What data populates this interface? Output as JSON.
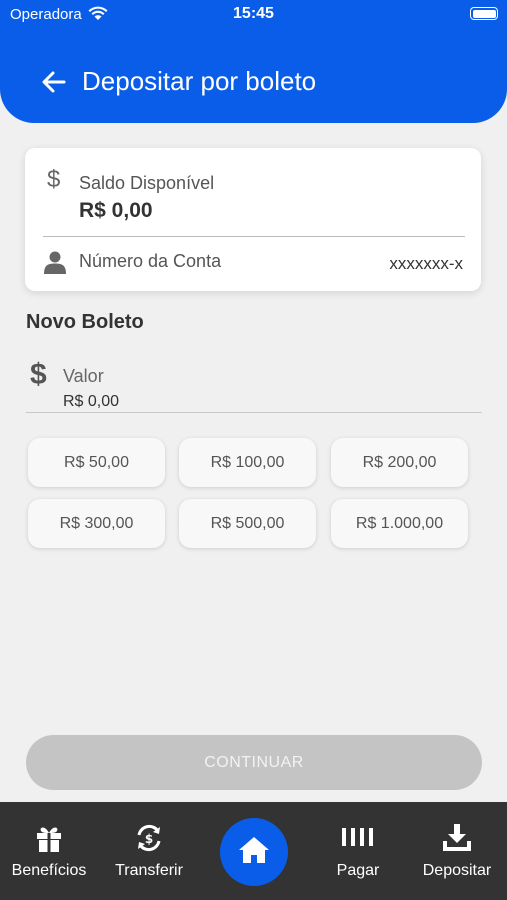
{
  "status_bar": {
    "carrier": "Operadora",
    "time": "15:45"
  },
  "header": {
    "title": "Depositar por boleto"
  },
  "account_card": {
    "balance_label": "Saldo Disponível",
    "balance_value": "R$ 0,00",
    "account_label": "Número da Conta",
    "account_value": "xxxxxxx-x"
  },
  "new_boleto": {
    "title": "Novo Boleto",
    "amount_label": "Valor",
    "amount_value": "R$ 0,00",
    "quick_amounts": [
      "R$ 50,00",
      "R$ 100,00",
      "R$ 200,00",
      "R$ 300,00",
      "R$ 500,00",
      "R$ 1.000,00"
    ]
  },
  "continue_label": "CONTINUAR",
  "bottom_nav": [
    {
      "label": "Benefícios",
      "icon": "gift-icon"
    },
    {
      "label": "Transferir",
      "icon": "transfer-icon"
    },
    {
      "label": "",
      "icon": "home-icon"
    },
    {
      "label": "Pagar",
      "icon": "barcode-icon"
    },
    {
      "label": "Depositar",
      "icon": "deposit-icon"
    }
  ],
  "colors": {
    "brand": "#0a5de8",
    "nav_bg": "#333333",
    "disabled_button": "#c4c4c4"
  }
}
